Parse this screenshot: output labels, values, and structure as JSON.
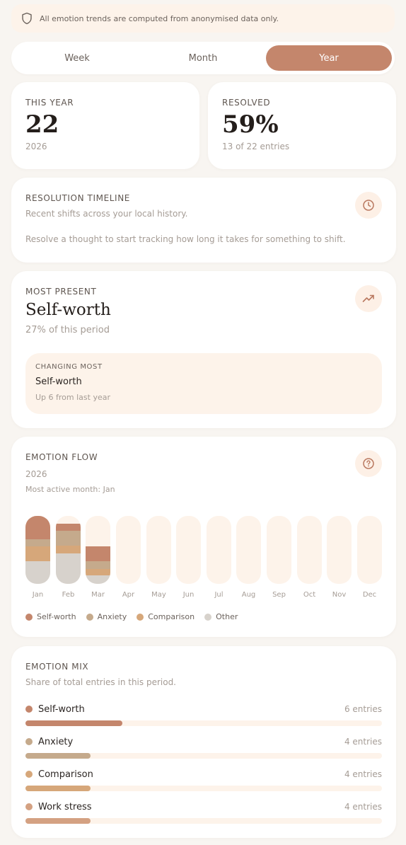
{
  "banner": {
    "text": "All emotion trends are computed from anonymised data only.",
    "icon": "shield-icon"
  },
  "period_tabs": [
    {
      "label": "Week",
      "active": false
    },
    {
      "label": "Month",
      "active": false
    },
    {
      "label": "Year",
      "active": true
    }
  ],
  "stats": {
    "this_year": {
      "label": "THIS YEAR",
      "value": "22",
      "sub": "2026"
    },
    "resolved": {
      "label": "RESOLVED",
      "value": "59%",
      "sub": "13 of 22 entries"
    }
  },
  "timeline": {
    "title": "RESOLUTION TIMELINE",
    "subtitle": "Recent shifts across your local history.",
    "empty_text": "Resolve a thought to start tracking how long it takes for something to shift.",
    "icon": "clock-icon"
  },
  "most_present": {
    "title": "MOST PRESENT",
    "emotion": "Self-worth",
    "share_text": "27% of this period",
    "icon": "trending-up-icon",
    "changing": {
      "label": "CHANGING MOST",
      "emotion": "Self-worth",
      "detail": "Up 6 from last year"
    }
  },
  "flow": {
    "title": "EMOTION FLOW",
    "year": "2026",
    "most_active": "Most active month: Jan",
    "icon": "help-circle-icon",
    "legend": [
      {
        "name": "Self-worth",
        "color": "#c4866c"
      },
      {
        "name": "Anxiety",
        "color": "#c5aa8c"
      },
      {
        "name": "Comparison",
        "color": "#d6a77a"
      },
      {
        "name": "Other",
        "color": "#d7d2cc"
      }
    ],
    "empty_color": "#fdf3ea",
    "months": [
      {
        "label": "Jan",
        "values": {
          "Self-worth": 0.34,
          "Anxiety": 0.11,
          "Comparison": 0.22,
          "Other": 0.33
        }
      },
      {
        "label": "Feb",
        "values": {
          "Self-worth": 0.11,
          "Anxiety": 0.22,
          "Comparison": 0.11,
          "Other": 0.45
        }
      },
      {
        "label": "Mar",
        "values": {
          "Self-worth": 0.22,
          "Anxiety": 0.11,
          "Comparison": 0.1,
          "Other": 0.12
        }
      },
      {
        "label": "Apr",
        "values": {}
      },
      {
        "label": "May",
        "values": {}
      },
      {
        "label": "Jun",
        "values": {}
      },
      {
        "label": "Jul",
        "values": {}
      },
      {
        "label": "Aug",
        "values": {}
      },
      {
        "label": "Sep",
        "values": {}
      },
      {
        "label": "Oct",
        "values": {}
      },
      {
        "label": "Nov",
        "values": {}
      },
      {
        "label": "Dec",
        "values": {}
      }
    ]
  },
  "mix": {
    "title": "EMOTION MIX",
    "subtitle": "Share of total entries in this period.",
    "items": [
      {
        "name": "Self-worth",
        "count_text": "6 entries",
        "count": 6,
        "color": "#c4866c"
      },
      {
        "name": "Anxiety",
        "count_text": "4 entries",
        "count": 4,
        "color": "#c5aa8c"
      },
      {
        "name": "Comparison",
        "count_text": "4 entries",
        "count": 4,
        "color": "#d6a77a"
      },
      {
        "name": "Work stress",
        "count_text": "4 entries",
        "count": 4,
        "color": "#d4a182"
      }
    ],
    "total": 22
  }
}
